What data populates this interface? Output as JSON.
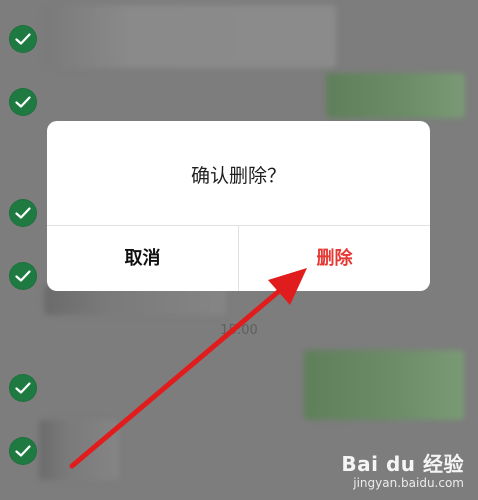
{
  "dialog": {
    "title": "确认删除？",
    "cancel_label": "取消",
    "delete_label": "删除",
    "delete_color": "#e53935"
  },
  "chat": {
    "time_label": "15:00"
  },
  "selection": {
    "check_color": "#1f7a42",
    "check_icon": "check-icon",
    "count_visible": 6
  },
  "annotation": {
    "arrow_color": "#e11c1c",
    "arrow_icon": "red-arrow-icon"
  },
  "watermark": {
    "brand": "Bai du 经验",
    "url": "jingyan.baidu.com"
  }
}
